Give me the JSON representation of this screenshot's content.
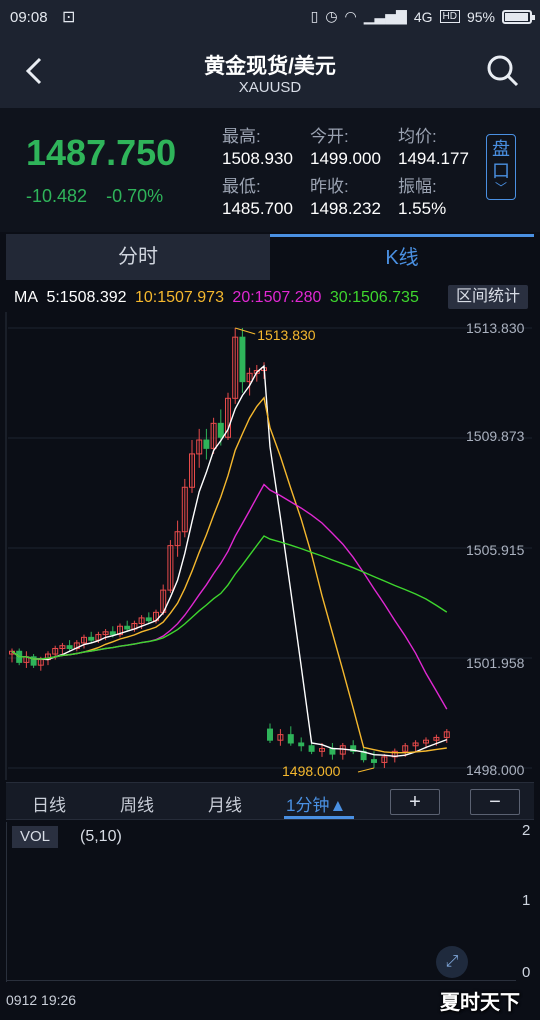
{
  "status_bar": {
    "time": "09:08",
    "notification_icon": "screenshot-icon",
    "network": "4G",
    "hd": "HD",
    "battery": "95%",
    "battery_level": 0.95
  },
  "header": {
    "title": "黄金现货/美元",
    "symbol": "XAUUSD"
  },
  "quote": {
    "price": "1487.750",
    "change": "-10.482",
    "change_pct": "-0.70%",
    "stats": [
      {
        "label": "最高:",
        "value": "1508.930"
      },
      {
        "label": "今开:",
        "value": "1499.000"
      },
      {
        "label": "均价:",
        "value": "1494.177"
      },
      {
        "label": "最低:",
        "value": "1485.700"
      },
      {
        "label": "昨收:",
        "value": "1498.232"
      },
      {
        "label": "振幅:",
        "value": "1.55%"
      }
    ],
    "pan_button": "盘口",
    "colors": {
      "down": "#2fb45a",
      "up": "#e84b4b",
      "accent": "#4a90e2"
    }
  },
  "tabs": [
    {
      "label": "分时",
      "active": false
    },
    {
      "label": "K线",
      "active": true
    }
  ],
  "ma": {
    "prefix": "MA",
    "ma5": "5:1508.392",
    "ma10": "10:1507.973",
    "ma20": "20:1507.280",
    "ma30": "30:1506.735",
    "colors": {
      "ma5": "#ffffff",
      "ma10": "#f5b82e",
      "ma20": "#e028d2",
      "ma30": "#3ed62e"
    }
  },
  "range_stats_button": "区间统计",
  "y_axis_labels": [
    "1513.830",
    "1509.873",
    "1505.915",
    "1501.958",
    "1498.000"
  ],
  "annotations": {
    "high": "1513.830",
    "low": "1498.000"
  },
  "periods": [
    {
      "label": "日线",
      "active": false
    },
    {
      "label": "周线",
      "active": false
    },
    {
      "label": "月线",
      "active": false
    },
    {
      "label": "1分钟▲",
      "active": true
    }
  ],
  "zoom": {
    "in": "+",
    "out": "−"
  },
  "volume": {
    "tag": "VOL",
    "params": "(5,10)",
    "axis_labels": [
      "2",
      "1",
      "0"
    ]
  },
  "bottom_time": "0912 19:26",
  "watermark": "夏时天下",
  "chart_data": {
    "type": "candlestick",
    "ylim": [
      1498.0,
      1513.83
    ],
    "y_ticks": [
      1513.83,
      1509.873,
      1505.915,
      1501.958,
      1498.0
    ],
    "candles": [
      [
        1502.1,
        1502.3,
        1501.8,
        1502.2
      ],
      [
        1502.2,
        1502.3,
        1501.7,
        1501.8
      ],
      [
        1501.8,
        1502.2,
        1501.6,
        1502.0
      ],
      [
        1502.0,
        1502.1,
        1501.6,
        1501.7
      ],
      [
        1501.7,
        1502.0,
        1501.5,
        1501.9
      ],
      [
        1501.9,
        1502.2,
        1501.7,
        1502.1
      ],
      [
        1502.1,
        1502.4,
        1501.9,
        1502.3
      ],
      [
        1502.3,
        1502.5,
        1502.1,
        1502.4
      ],
      [
        1502.4,
        1502.6,
        1502.2,
        1502.3
      ],
      [
        1502.3,
        1502.6,
        1502.2,
        1502.5
      ],
      [
        1502.5,
        1502.8,
        1502.3,
        1502.7
      ],
      [
        1502.7,
        1502.9,
        1502.5,
        1502.6
      ],
      [
        1502.6,
        1502.9,
        1502.5,
        1502.8
      ],
      [
        1502.8,
        1503.0,
        1502.6,
        1502.9
      ],
      [
        1502.9,
        1503.1,
        1502.7,
        1502.8
      ],
      [
        1502.8,
        1503.2,
        1502.7,
        1503.1
      ],
      [
        1503.1,
        1503.3,
        1502.9,
        1503.0
      ],
      [
        1503.0,
        1503.3,
        1502.9,
        1503.2
      ],
      [
        1503.2,
        1503.5,
        1503.0,
        1503.4
      ],
      [
        1503.4,
        1503.6,
        1503.2,
        1503.3
      ],
      [
        1503.3,
        1503.7,
        1503.2,
        1503.6
      ],
      [
        1503.6,
        1504.6,
        1503.5,
        1504.4
      ],
      [
        1504.4,
        1506.2,
        1504.3,
        1506.0
      ],
      [
        1506.0,
        1506.9,
        1505.6,
        1506.5
      ],
      [
        1506.5,
        1508.4,
        1506.3,
        1508.1
      ],
      [
        1508.1,
        1509.8,
        1507.9,
        1509.3
      ],
      [
        1509.3,
        1510.2,
        1508.8,
        1509.8
      ],
      [
        1509.8,
        1510.2,
        1509.1,
        1509.5
      ],
      [
        1509.5,
        1510.6,
        1509.3,
        1510.4
      ],
      [
        1510.4,
        1510.9,
        1509.6,
        1509.9
      ],
      [
        1509.9,
        1511.5,
        1509.8,
        1511.3
      ],
      [
        1511.3,
        1513.83,
        1511.1,
        1513.5
      ],
      [
        1513.5,
        1513.83,
        1511.5,
        1511.9
      ],
      [
        1511.9,
        1512.4,
        1511.4,
        1512.2
      ],
      [
        1512.2,
        1512.5,
        1511.9,
        1512.3
      ],
      [
        1512.3,
        1512.6,
        1512.0,
        1512.4
      ],
      [
        1499.4,
        1499.6,
        1498.9,
        1499.0
      ],
      [
        1499.0,
        1499.4,
        1498.8,
        1499.2
      ],
      [
        1499.2,
        1499.5,
        1498.8,
        1498.9
      ],
      [
        1498.9,
        1499.1,
        1498.6,
        1498.8
      ],
      [
        1498.8,
        1499.0,
        1498.5,
        1498.6
      ],
      [
        1498.6,
        1498.9,
        1498.4,
        1498.7
      ],
      [
        1498.7,
        1498.9,
        1498.3,
        1498.5
      ],
      [
        1498.5,
        1498.9,
        1498.3,
        1498.8
      ],
      [
        1498.8,
        1499.0,
        1498.5,
        1498.6
      ],
      [
        1498.6,
        1498.8,
        1498.2,
        1498.3
      ],
      [
        1498.3,
        1498.6,
        1498.0,
        1498.2
      ],
      [
        1498.2,
        1498.5,
        1498.0,
        1498.4
      ],
      [
        1498.4,
        1498.7,
        1498.2,
        1498.6
      ],
      [
        1498.6,
        1498.9,
        1498.4,
        1498.8
      ],
      [
        1498.8,
        1499.0,
        1498.6,
        1498.9
      ],
      [
        1498.9,
        1499.1,
        1498.7,
        1499.0
      ],
      [
        1499.0,
        1499.2,
        1498.8,
        1499.1
      ],
      [
        1499.1,
        1499.4,
        1498.9,
        1499.3
      ]
    ]
  }
}
